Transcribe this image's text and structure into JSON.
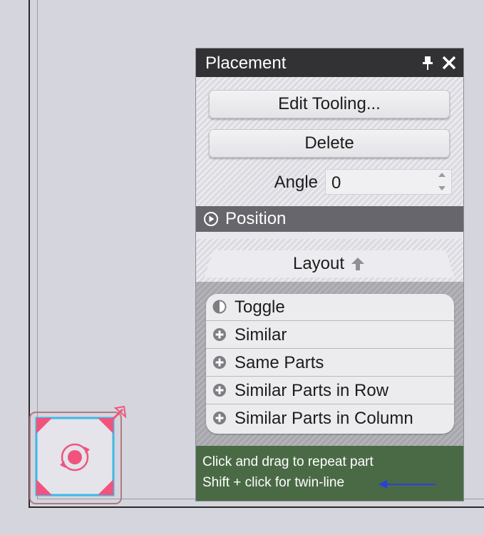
{
  "panel": {
    "title": "Placement",
    "edit_tooling_label": "Edit Tooling...",
    "delete_label": "Delete",
    "angle_label": "Angle",
    "angle_value": "0",
    "position_label": "Position",
    "layout_label": "Layout",
    "options": [
      {
        "label": "Toggle",
        "icon": "half-circle-icon"
      },
      {
        "label": "Similar",
        "icon": "plus-circle-icon"
      },
      {
        "label": "Same Parts",
        "icon": "plus-circle-icon"
      },
      {
        "label": "Similar Parts in Row",
        "icon": "plus-circle-icon"
      },
      {
        "label": "Similar Parts in Column",
        "icon": "plus-circle-icon"
      }
    ],
    "hint_line1": "Click and drag to repeat part",
    "hint_line2": "Shift + click for twin-line"
  },
  "colors": {
    "header_bg": "#323235",
    "position_bar_bg": "#66666c",
    "hint_bg": "#4a6a45",
    "widget_accent": "#f0547e",
    "widget_border": "#3fb7e8",
    "hint_arrow": "#2a3fe0"
  }
}
